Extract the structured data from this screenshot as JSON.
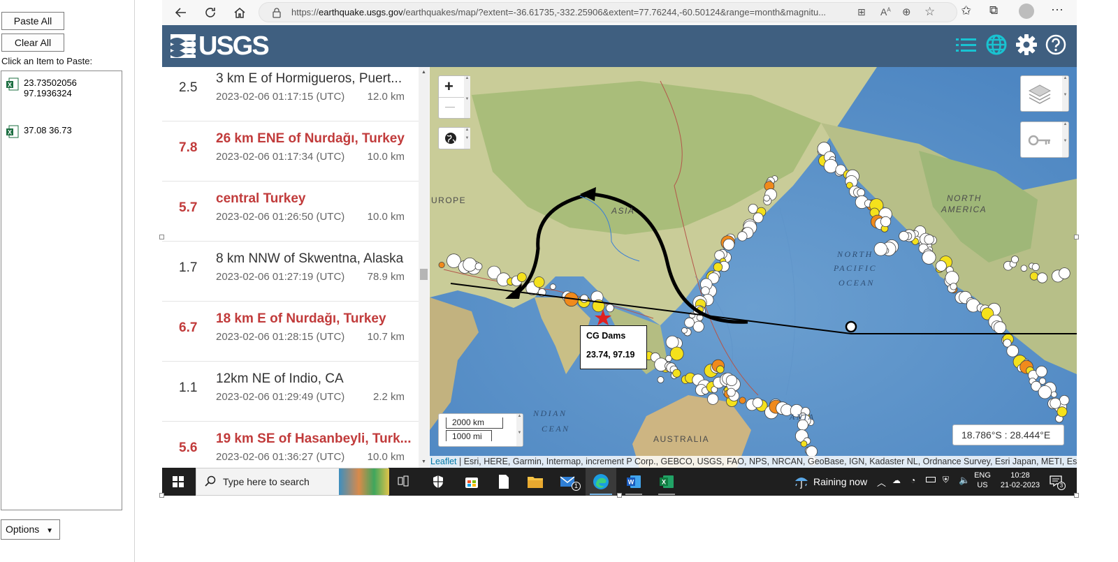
{
  "clipboard": {
    "paste_all": "Paste All",
    "clear_all": "Clear All",
    "label": "Click an Item to Paste:",
    "items": [
      {
        "line1": "23.73502056",
        "line2": "97.1936324"
      },
      {
        "line1": "37.08 36.73",
        "line2": ""
      }
    ],
    "options": "Options"
  },
  "browser": {
    "url_prefix": "https://",
    "url_domain": "earthquake.usgs.gov",
    "url_path": "/earthquakes/map/?extent=-36.61735,-332.25906&extent=77.76244,-60.50124&range=month&magnitu..."
  },
  "usgs": {
    "logo_text": "USGS",
    "colors": {
      "header": "#3f5f80",
      "accent": "#19c3d1",
      "big_quake": "#c13b3b"
    }
  },
  "earthquakes": [
    {
      "mag": "2.5",
      "place": "3 km E of Hormigueros, Puert...",
      "time": "2023-02-06 01:17:15 (UTC)",
      "depth": "12.0 km",
      "big": false
    },
    {
      "mag": "7.8",
      "place": "26 km ENE of Nurdağı, Turkey",
      "time": "2023-02-06 01:17:34 (UTC)",
      "depth": "10.0 km",
      "big": true
    },
    {
      "mag": "5.7",
      "place": "central Turkey",
      "time": "2023-02-06 01:26:50 (UTC)",
      "depth": "10.0 km",
      "big": true
    },
    {
      "mag": "1.7",
      "place": "8 km NNW of Skwentna, Alaska",
      "time": "2023-02-06 01:27:19 (UTC)",
      "depth": "78.9 km",
      "big": false
    },
    {
      "mag": "6.7",
      "place": "18 km E of Nurdağı, Turkey",
      "time": "2023-02-06 01:28:15 (UTC)",
      "depth": "10.7 km",
      "big": true
    },
    {
      "mag": "1.1",
      "place": "12km NE of Indio, CA",
      "time": "2023-02-06 01:29:49 (UTC)",
      "depth": "2.2 km",
      "big": false
    },
    {
      "mag": "5.6",
      "place": "19 km SE of Hasanbeyli, Turk...",
      "time": "2023-02-06 01:36:27 (UTC)",
      "depth": "10.0 km",
      "big": true
    }
  ],
  "map": {
    "labels": {
      "europe": "UROPE",
      "asia": "ASIA",
      "north_america_1": "NORTH",
      "north_america_2": "AMERICA",
      "npo_1": "NORTH",
      "npo_2": "PACIFIC",
      "npo_3": "OCEAN",
      "indian_1": "NDIAN",
      "indian_2": "CEAN",
      "australia": "AUSTRALIA",
      "ania": "ANIA"
    },
    "zoom_in": "+",
    "zoom_out": "—",
    "scale_km": "2000 km",
    "scale_mi": "1000 mi",
    "coords": "18.786°S : 28.444°E",
    "popup_title": "CG Dams",
    "popup_coords": "23.74, 97.19",
    "attribution_leaflet": "Leaflet",
    "attribution_rest": " | Esri, HERE, Garmin, Intermap, increment P Corp., GEBCO, USGS, FAO, NPS, NRCAN, GeoBase, IGN, Kadaster NL, Ordnance Survey, Esri Japan, METI, Es..."
  },
  "taskbar": {
    "search_placeholder": "Type here to search",
    "weather": "Raining now",
    "lang1": "ENG",
    "lang2": "US",
    "time": "10:28",
    "date": "21-02-2023",
    "mail_badge": "1",
    "notif_badge": "3"
  }
}
